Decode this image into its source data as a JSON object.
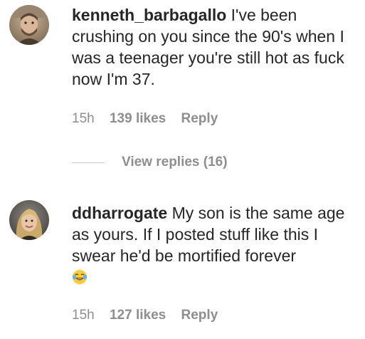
{
  "comments": [
    {
      "username": "kenneth_barbagallo",
      "text": "I've been crushing on you since the 90's when I was a teenager you're still hot as fuck now I'm 37.",
      "time": "15h",
      "likes": "139 likes",
      "reply_label": "Reply",
      "avatar_icon": "profile-photo-man-beard",
      "view_replies": "View replies (16)"
    },
    {
      "username": "ddharrogate",
      "text": "My son is the same age as yours. If I posted stuff like this I swear he'd be mortified forever",
      "emoji": "face-with-tears-of-joy-emoji",
      "time": "15h",
      "likes": "127 likes",
      "reply_label": "Reply",
      "avatar_icon": "profile-photo-woman-blonde"
    }
  ],
  "colors": {
    "text": "#262626",
    "meta": "#8e8e8e",
    "divider": "#c7c7c7"
  }
}
